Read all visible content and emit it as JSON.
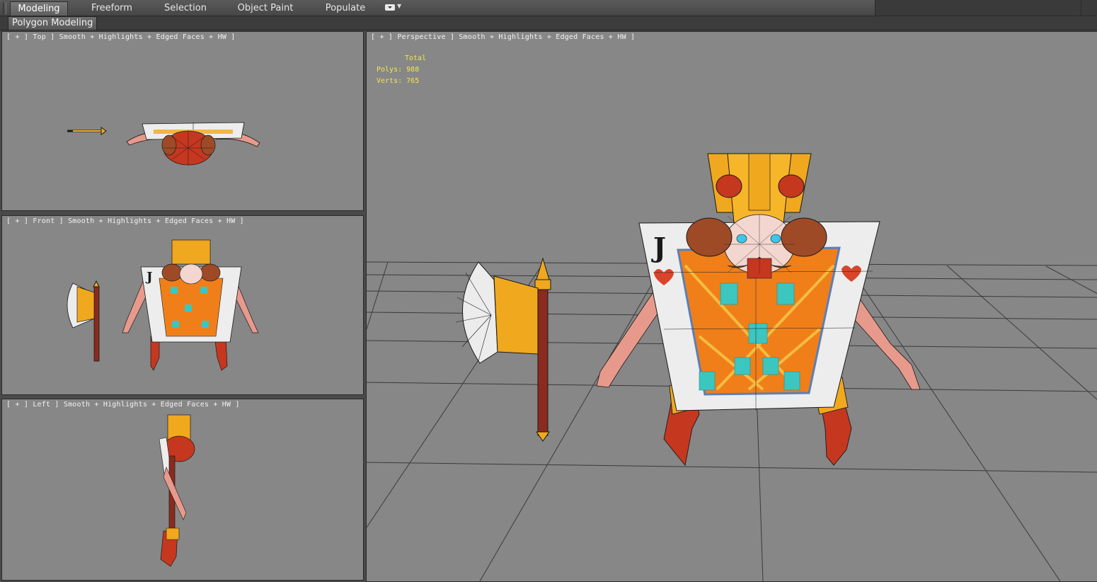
{
  "ribbon": {
    "tabs": [
      {
        "label": "Modeling",
        "active": true
      },
      {
        "label": "Freeform",
        "active": false
      },
      {
        "label": "Selection",
        "active": false
      },
      {
        "label": "Object Paint",
        "active": false
      },
      {
        "label": "Populate",
        "active": false
      }
    ],
    "menu_icon": "ribbon-options-icon"
  },
  "subbar": {
    "panel_label": "Polygon Modeling"
  },
  "viewports": {
    "top": {
      "label": "[ + ] Top ] Smooth + Highlights + Edged Faces + HW ]"
    },
    "front": {
      "label": "[ + ] Front ] Smooth + Highlights + Edged Faces + HW ]"
    },
    "left": {
      "label": "[ + ] Left ] Smooth + Highlights + Edged Faces + HW ]"
    },
    "perspective": {
      "label": "[ + ] Perspective ] Smooth + Highlights + Edged Faces + HW ]",
      "stats": {
        "header": "Total",
        "polys_label": "Polys:",
        "polys_value": "988",
        "verts_label": "Verts:",
        "verts_value": "765"
      }
    }
  },
  "model": {
    "card_letter": "J",
    "colors": {
      "viewport_bg": "#878787",
      "gold": "#f0a81e",
      "orange": "#f07f1a",
      "red": "#c6371f",
      "teal": "#3cc6c0",
      "skin": "#e79a8c",
      "card_white": "#eeeeee",
      "wire": "#1a1a1a"
    }
  }
}
